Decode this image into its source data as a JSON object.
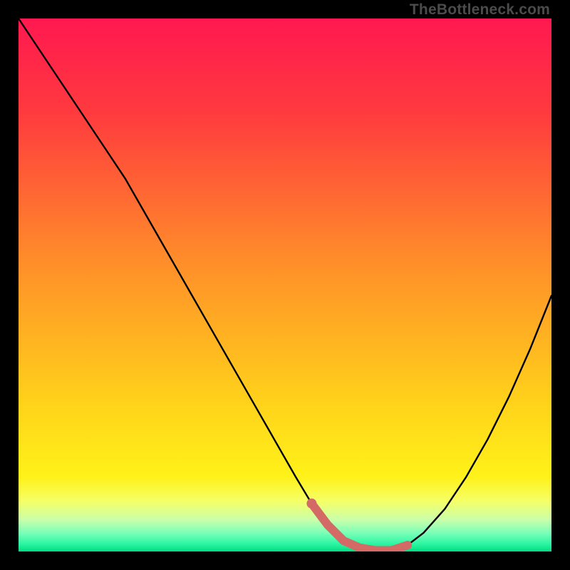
{
  "watermark": "TheBottleneck.com",
  "colors": {
    "black": "#000000",
    "highlight": "#d36a66",
    "gradient_stops": [
      {
        "id": "s0",
        "color": "#ff1850"
      },
      {
        "id": "s1",
        "color": "#ff3b3e"
      },
      {
        "id": "s2",
        "color": "#ff8c2a"
      },
      {
        "id": "s3",
        "color": "#ffd21a"
      },
      {
        "id": "s4",
        "color": "#fff219"
      },
      {
        "id": "s5",
        "color": "#f6ff66"
      },
      {
        "id": "s6",
        "color": "#cbffa9"
      },
      {
        "id": "s7",
        "color": "#7bffb8"
      },
      {
        "id": "s8",
        "color": "#2ff6a5"
      },
      {
        "id": "s9",
        "color": "#00de82"
      }
    ]
  },
  "chart_data": {
    "type": "line",
    "title": "",
    "xlabel": "",
    "ylabel": "",
    "xlim": [
      0,
      100
    ],
    "ylim": [
      0,
      100
    ],
    "series": [
      {
        "name": "bottleneck-curve",
        "x": [
          0,
          4,
          8,
          12,
          16,
          20,
          24,
          28,
          32,
          36,
          40,
          44,
          48,
          52,
          55,
          58,
          61,
          64,
          67,
          70,
          73,
          76,
          80,
          84,
          88,
          92,
          96,
          100
        ],
        "y": [
          100,
          94,
          88,
          82,
          76,
          70,
          63,
          56,
          49,
          42,
          35,
          28,
          21,
          14,
          9,
          5,
          2,
          0.7,
          0.2,
          0.2,
          1.2,
          3.5,
          8,
          14,
          21,
          29,
          38,
          48
        ]
      }
    ],
    "highlight": {
      "name": "optimal-range",
      "x": [
        55,
        58,
        61,
        64,
        67,
        70,
        73
      ],
      "y": [
        9,
        5,
        2,
        0.7,
        0.2,
        0.2,
        1.2
      ],
      "dot": {
        "x": 55,
        "y": 9
      }
    },
    "annotations": []
  }
}
